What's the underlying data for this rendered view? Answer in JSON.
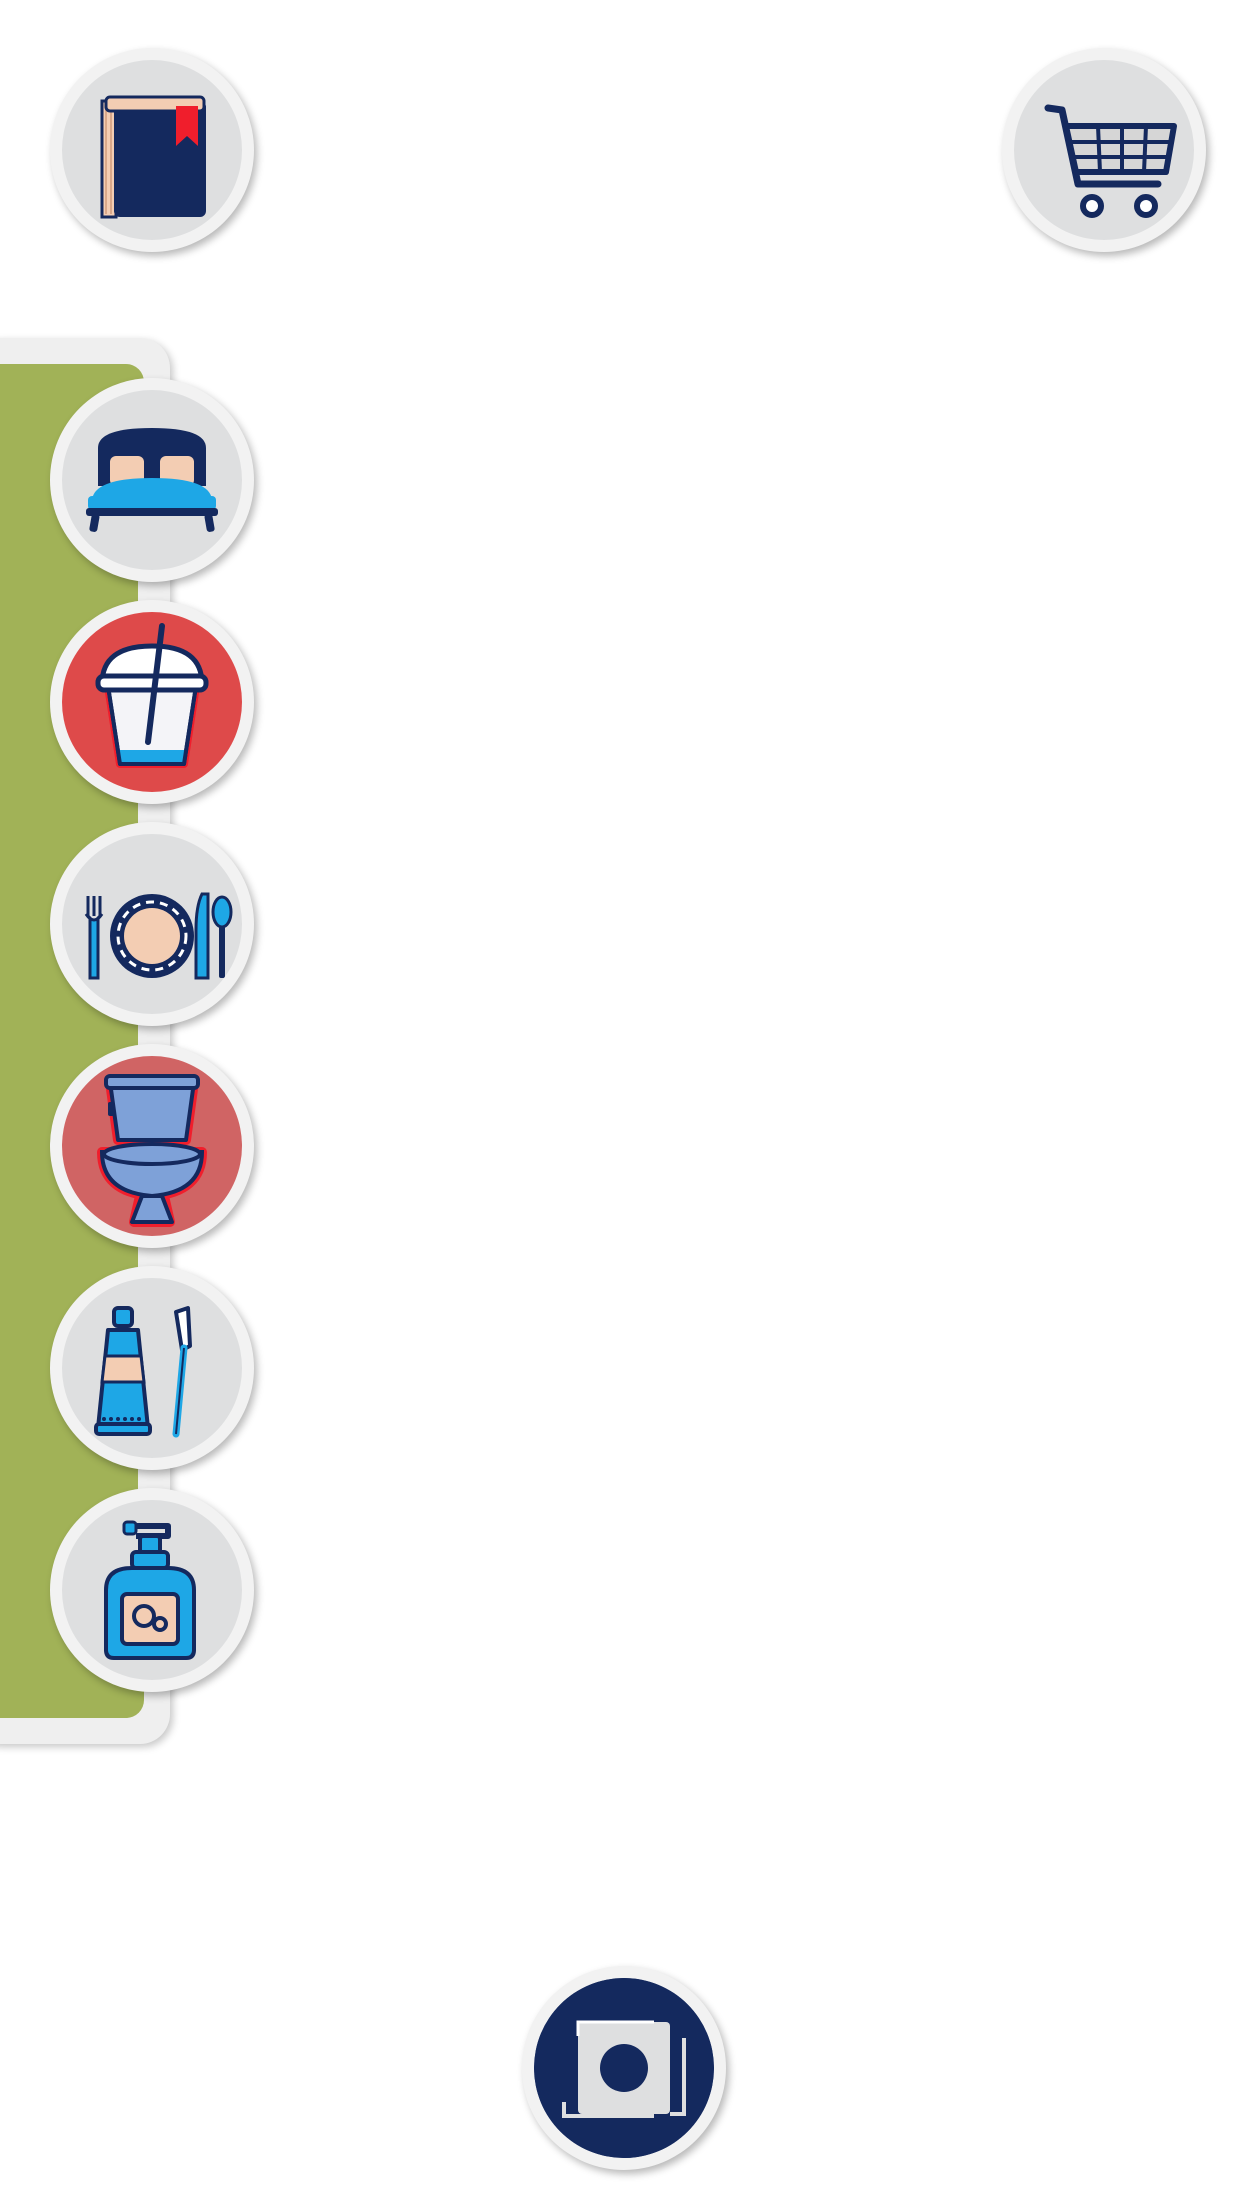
{
  "header": {
    "left_button": {
      "icon": "book-icon"
    },
    "right_button": {
      "icon": "shopping-cart-icon"
    }
  },
  "category_panel": {
    "background_color": "#a1b257",
    "items": [
      {
        "icon": "bed-icon",
        "selected": false
      },
      {
        "icon": "drink-cup-icon",
        "selected": true
      },
      {
        "icon": "plate-cutlery-icon",
        "selected": false
      },
      {
        "icon": "toilet-icon",
        "selected": true
      },
      {
        "icon": "toothpaste-toothbrush-icon",
        "selected": false
      },
      {
        "icon": "soap-dispenser-icon",
        "selected": false
      }
    ]
  },
  "footer": {
    "center_button": {
      "icon": "camera-scan-icon"
    }
  },
  "colors": {
    "navy": "#14295e",
    "blue": "#1ea7e6",
    "peach": "#f3cdb3",
    "selected_red": "#de4a4a",
    "button_grey": "#dedfe0"
  }
}
